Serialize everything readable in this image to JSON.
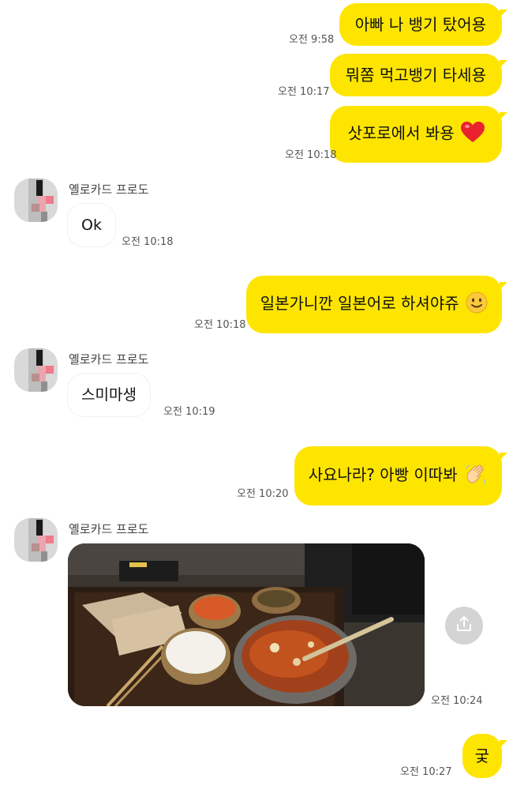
{
  "sender_name": "옐로카드 프로도",
  "messages": [
    {
      "text": "아빠 나 뱅기 탔어용",
      "time": "오전 9:58"
    },
    {
      "text": "뭐쫌 먹고뱅기 타세용",
      "time": "오전 10:17"
    },
    {
      "text": "삿포로에서 봐용",
      "time": "오전 10:18"
    },
    {
      "text": "Ok",
      "time": "오전 10:18"
    },
    {
      "text": "일본가니깐 일본어로 하셔야쥬",
      "time": "오전 10:18"
    },
    {
      "text": "스미마생",
      "time": "오전 10:19"
    },
    {
      "text": "사요나라? 아빵 이따봐",
      "time": "오전 10:20"
    },
    {
      "text": "",
      "time": "오전 10:24"
    },
    {
      "text": "궃",
      "time": "오전 10:27"
    }
  ],
  "icons": {
    "heart": "heart-icon",
    "smile": "smiling-face-icon",
    "wave": "waving-hand-icon",
    "share": "share-icon"
  },
  "colors": {
    "outgoing_bubble": "#fee500",
    "incoming_bubble": "#ffffff",
    "background": "#ffffff"
  }
}
